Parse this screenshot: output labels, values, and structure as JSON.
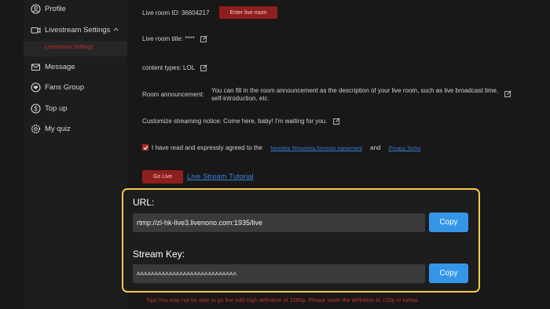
{
  "sidebar": {
    "items": [
      {
        "label": "Profile",
        "icon": "user-circle-icon"
      },
      {
        "label": "Livestream Settings",
        "icon": "camera-icon"
      },
      {
        "label": "Message",
        "icon": "mail-icon"
      },
      {
        "label": "Fans Group",
        "icon": "heart-icon"
      },
      {
        "label": "Top up",
        "icon": "dollar-icon"
      },
      {
        "label": "My quiz",
        "icon": "gear-icon"
      }
    ],
    "sub_item": "Livestream Settings"
  },
  "main": {
    "room_id_label": "Live room ID:",
    "room_id": "36604217",
    "enter_room_button": "Enter live room",
    "title_label": "Live room title:",
    "title_value": "****",
    "content_label": "content types:",
    "content_value": "LOL",
    "announcement_label": "Room announcement:",
    "announcement_line1": "You can fill in the room announcement as the description of your live room, such as live broadcast time,",
    "announcement_line2": "self-introduction, etc.",
    "notice_label": "Customize streaming notice:",
    "notice_value": "Come here, baby! I'm waiting for you.",
    "agree_text": "I have read and expressly agreed to the",
    "agreement_link": "Nonolive Streaming Services Agreement",
    "and_text": "and",
    "privacy_link": "Privacy Terms",
    "go_live_button": "Go Live",
    "tutorial_link": "Live Stream Tutorial"
  },
  "stream": {
    "url_label": "URL:",
    "url_value": "rtmp://zl-hk-live3.livenono.com:1935/live",
    "key_label": "Stream Key:",
    "key_value": "AAAAAAAAAAAAAAAAAAAAAAAAAAAA",
    "copy_label": "Copy"
  },
  "tips": "Tips:You may not be able to go live with high definition of 1080p. Please lower the definition to 720p or below.",
  "colors": {
    "accent_red": "#8f1e1e",
    "highlight_border": "#f0cc4a",
    "copy_blue": "#3596e8",
    "link_blue": "#3a82d4"
  }
}
